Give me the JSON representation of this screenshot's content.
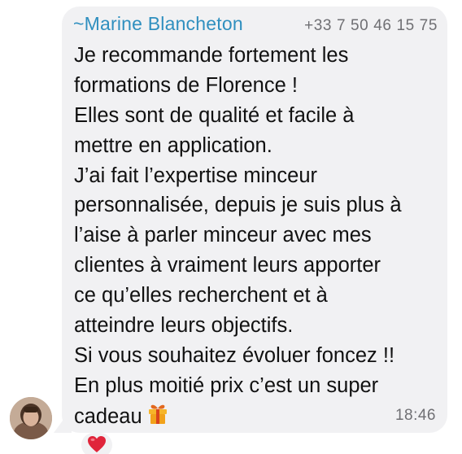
{
  "message": {
    "sender_name": "~Marine Blancheton",
    "sender_phone": "+33 7 50 46 15 75",
    "lines": [
      "Je recommande fortement les",
      "formations de Florence !",
      "Elles sont de qualité et facile à",
      "mettre en application.",
      "J’ai fait l’expertise minceur",
      "personnalisée, depuis je suis plus à",
      "l’aise à parler minceur avec mes",
      "clientes à vraiment leurs apporter",
      "ce qu’elles recherchent et à",
      "atteindre leurs objectifs.",
      "Si vous souhaitez évoluer foncez !!",
      "En plus moitié prix c’est un super",
      "cadeau"
    ],
    "time": "18:46",
    "inline_emoji": "gift-icon",
    "reaction": "heart-icon"
  },
  "colors": {
    "bubble": "#f1f1f3",
    "sender": "#2f8fbf",
    "meta_text": "#6f6f73",
    "heart": "#e0243a",
    "gift": "#f2a21b"
  }
}
